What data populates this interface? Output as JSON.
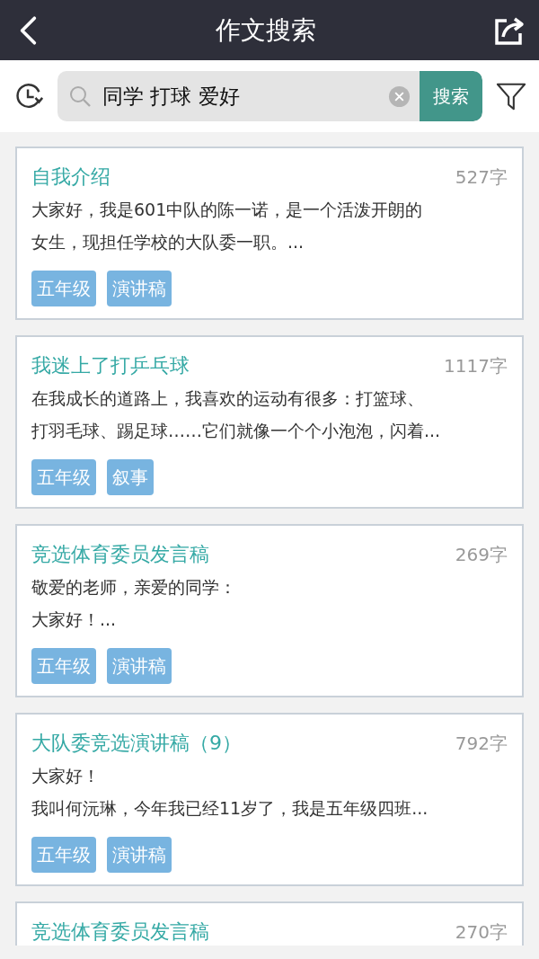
{
  "header": {
    "title": "作文搜索"
  },
  "search": {
    "value": "同学 打球 爱好",
    "button": "搜索"
  },
  "results": [
    {
      "title": "自我介绍",
      "count": "527字",
      "lines": [
        "大家好，我是601中队的陈一诺，是一个活泼开朗的",
        "女生，现担任学校的大队委一职。..."
      ],
      "tags": [
        "五年级",
        "演讲稿"
      ]
    },
    {
      "title": "我迷上了打乒乓球",
      "count": "1117字",
      "lines": [
        "在我成长的道路上，我喜欢的运动有很多：打篮球、",
        "打羽毛球、踢足球……它们就像一个个小泡泡，闪着..."
      ],
      "tags": [
        "五年级",
        "叙事"
      ]
    },
    {
      "title": "竞选体育委员发言稿",
      "count": "269字",
      "lines": [
        "敬爱的老师，亲爱的同学：",
        "大家好！..."
      ],
      "tags": [
        "五年级",
        "演讲稿"
      ]
    },
    {
      "title": "大队委竞选演讲稿（9）",
      "count": "792字",
      "lines": [
        "大家好！",
        "我叫何沅琳，今年我已经11岁了，我是五年级四班..."
      ],
      "tags": [
        "五年级",
        "演讲稿"
      ]
    },
    {
      "title": "竞选体育委员发言稿",
      "count": "270字"
    }
  ]
}
